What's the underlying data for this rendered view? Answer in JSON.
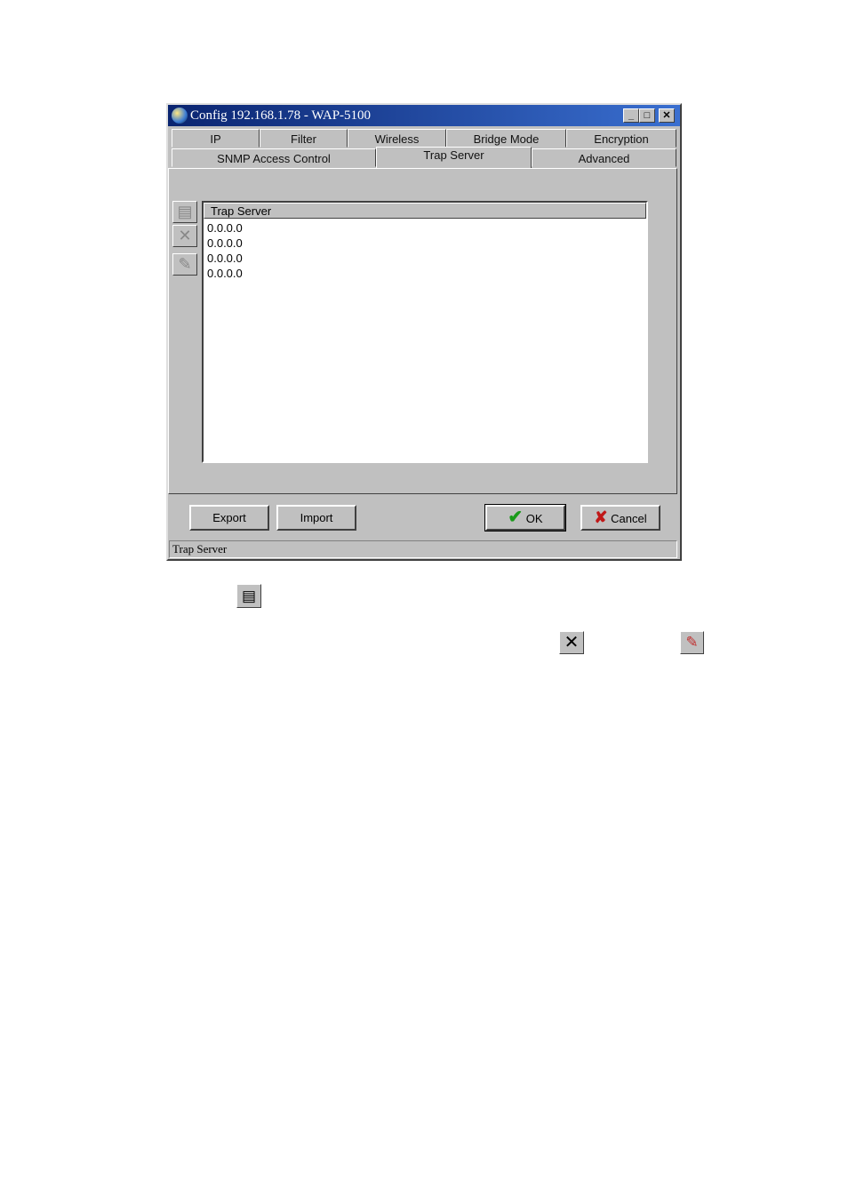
{
  "window": {
    "title": "Config 192.168.1.78 - WAP-5100",
    "minimize": "_",
    "maximize": "□",
    "close": "✕"
  },
  "tabs_row1": [
    {
      "label": "IP"
    },
    {
      "label": "Filter"
    },
    {
      "label": "Wireless"
    },
    {
      "label": "Bridge Mode"
    },
    {
      "label": "Encryption"
    }
  ],
  "tabs_row2": [
    {
      "label": "SNMP Access Control"
    },
    {
      "label": "Trap Server",
      "selected": true
    },
    {
      "label": "Advanced"
    }
  ],
  "side_buttons": [
    {
      "icon": "edit-properties-icon"
    },
    {
      "icon": "delete-x-icon"
    },
    {
      "icon": "clear-eraser-icon"
    }
  ],
  "list": {
    "header": "Trap Server",
    "rows": [
      "0.0.0.0",
      "0.0.0.0",
      "0.0.0.0",
      "0.0.0.0"
    ]
  },
  "buttons": {
    "export": "Export",
    "import": "Import",
    "ok": "OK",
    "cancel": "Cancel"
  },
  "status": "Trap Server",
  "colors": {
    "ok_check": "#1a9a1a",
    "cancel_x": "#c01818",
    "title_start": "#0a2470",
    "title_end": "#3a6fd0"
  }
}
